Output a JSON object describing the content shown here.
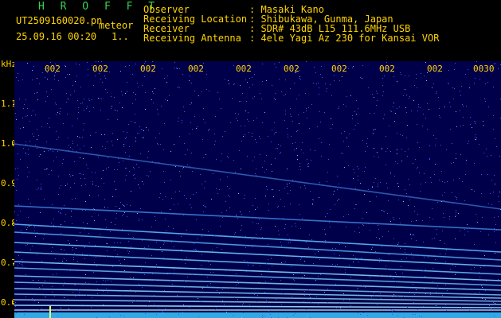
{
  "header": {
    "app_title": "H R O F F T",
    "filename": "UT2509160020.pn",
    "tag": "meteor",
    "datetime": "25.09.16 00:20",
    "counter": "1..",
    "fields": [
      {
        "label": "Observer",
        "value": ": Masaki Kano"
      },
      {
        "label": "Receiving Location",
        "value": ": Shibukawa, Gunma, Japan"
      },
      {
        "label": "Receiver",
        "value": ": SDR# 43dB L15 111.6MHz USB"
      },
      {
        "label": "Receiving Antenna",
        "value": ": 4ele Yagi Az 230 for Kansai VOR"
      }
    ]
  },
  "axes": {
    "y_unit": "kHz",
    "y_ticks": [
      "1.1",
      "1.0",
      "0.9",
      "0.8",
      "0.7",
      "0.6"
    ],
    "x_ticks": [
      "002",
      "002",
      "002",
      "002",
      "002",
      "002",
      "002",
      "002",
      "002",
      "0030"
    ]
  },
  "colors": {
    "background": "#000000",
    "spectrum_bg": "#00004a",
    "trace": "#5ab8ff",
    "label": "#ffd400",
    "title": "#39d353"
  }
}
